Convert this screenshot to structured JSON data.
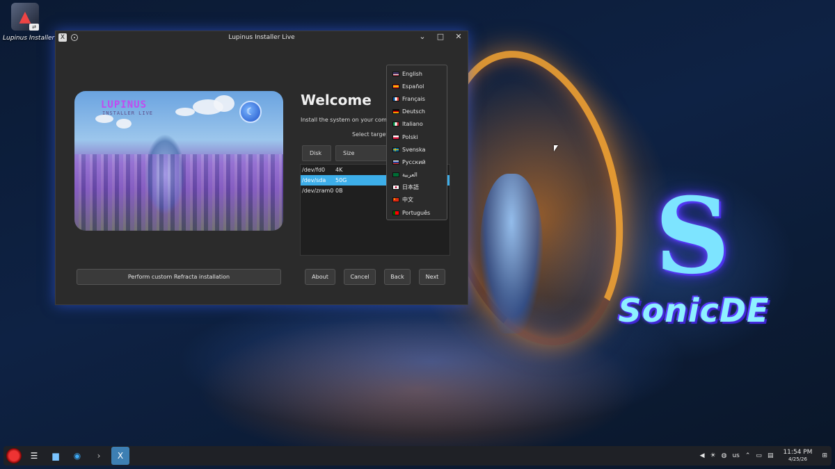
{
  "desktop": {
    "icon_label": "Lupinus Installer",
    "wallpaper_title": "SonicDE"
  },
  "window": {
    "title": "Lupinus Installer Live",
    "minimize_glyph": "⌄",
    "maximize_glyph": "□",
    "close_glyph": "✕"
  },
  "hero": {
    "title": "LUPINUS",
    "subtitle": "INSTALLER LIVE"
  },
  "welcome": {
    "heading": "Welcome",
    "subtitle": "Install the system on your comp",
    "select_target": "Select target"
  },
  "disk_table": {
    "columns": [
      "Disk",
      "Size"
    ],
    "rows": [
      {
        "disk": "/dev/fd0",
        "size": "4K"
      },
      {
        "disk": "/dev/sda",
        "size": "50G",
        "selected": true
      },
      {
        "disk": "/dev/zram0",
        "size": "0B"
      }
    ]
  },
  "buttons": {
    "custom": "Perform custom Refracta installation",
    "about": "About",
    "cancel": "Cancel",
    "back": "Back",
    "next": "Next"
  },
  "language_menu": {
    "items": [
      {
        "label": "English",
        "flag": "us"
      },
      {
        "label": "Español",
        "flag": "es"
      },
      {
        "label": "Français",
        "flag": "fr"
      },
      {
        "label": "Deutsch",
        "flag": "de"
      },
      {
        "label": "Italiano",
        "flag": "it"
      },
      {
        "label": "Polski",
        "flag": "pl"
      },
      {
        "label": "Svenska",
        "flag": "se"
      },
      {
        "label": "Русский",
        "flag": "ru"
      },
      {
        "label": "العربية",
        "flag": "sa"
      },
      {
        "label": "日本語",
        "flag": "jp"
      },
      {
        "label": "中文",
        "flag": "cn"
      },
      {
        "label": "Português",
        "flag": "pt"
      }
    ]
  },
  "taskbar": {
    "keyboard_layout": "us",
    "time": "11:54 PM",
    "date": "4/25/26"
  },
  "colors": {
    "selection": "#3daee9",
    "window_bg": "#2b2b2b"
  }
}
